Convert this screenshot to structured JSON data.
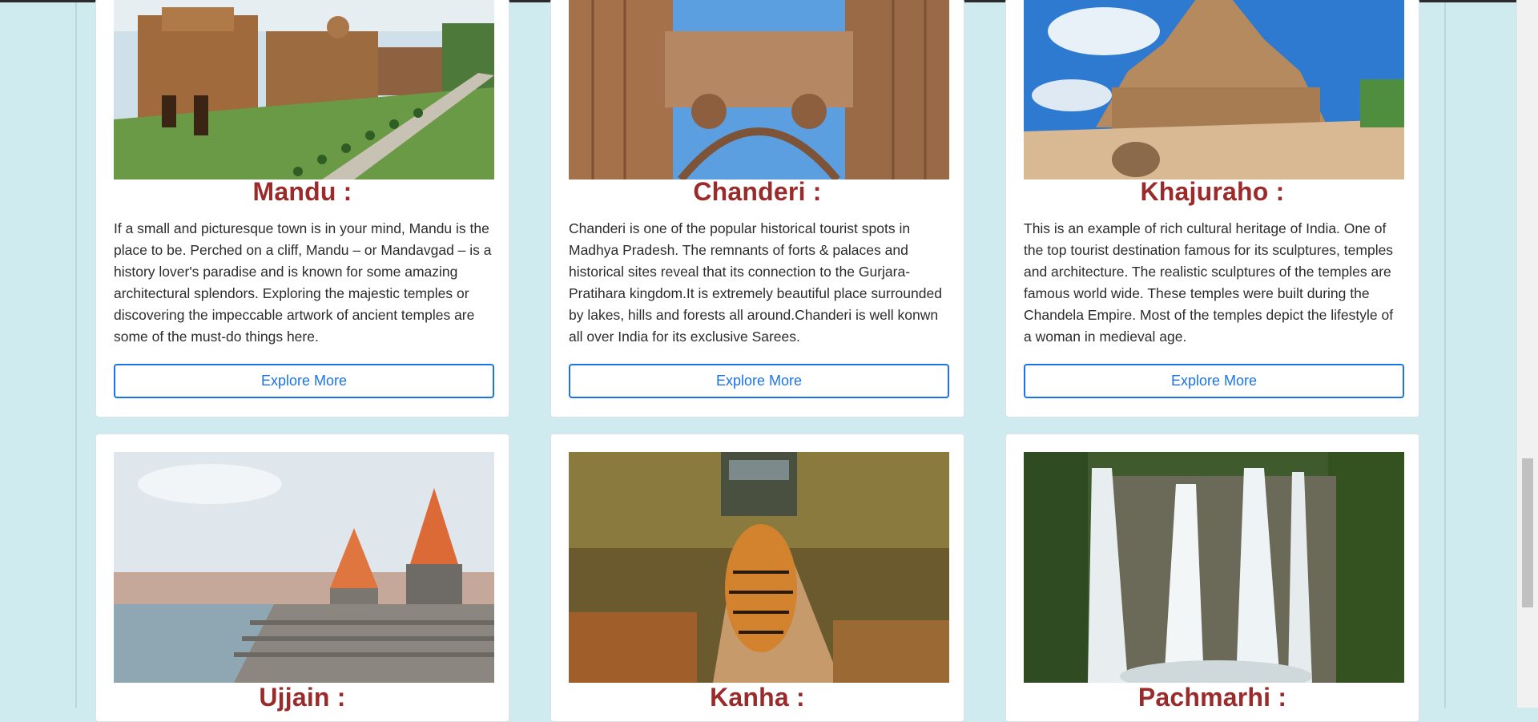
{
  "destinations": [
    {
      "title": "Mandu :",
      "image": "mandu-palace-photo",
      "description": "If a small and picturesque town is in your mind, Mandu is the place to be. Perched on a cliff, Mandu – or Mandavgad – is a history lover's paradise and is known for some amazing architectural splendors. Exploring the majestic temples or discovering the impeccable artwork of ancient temples are some of the must-do things here.",
      "button": "Explore More"
    },
    {
      "title": "Chanderi :",
      "image": "chanderi-gate-photo",
      "description": "Chanderi is one of the popular historical tourist spots in Madhya Pradesh. The remnants of forts & palaces and historical sites reveal that its connection to the Gurjara-Pratihara kingdom.It is extremely beautiful place surrounded by lakes, hills and forests all around.Chanderi is well konwn all over India for its exclusive Sarees.",
      "button": "Explore More"
    },
    {
      "title": "Khajuraho :",
      "image": "khajuraho-temple-photo",
      "description": "This is an example of rich cultural heritage of India. One of the top tourist destination famous for its sculptures, temples and architecture. The realistic sculptures of the temples are famous world wide. These temples were built during the Chandela Empire. Most of the temples depict the lifestyle of a woman in medieval age.",
      "button": "Explore More"
    },
    {
      "title": "Ujjain :",
      "image": "ujjain-ghat-photo"
    },
    {
      "title": "Kanha :",
      "image": "kanha-tiger-photo"
    },
    {
      "title": "Pachmarhi :",
      "image": "pachmarhi-waterfall-photo"
    }
  ],
  "colors": {
    "page_bg": "#cfebef",
    "heading": "#9b2b2b",
    "button": "#1a73e8"
  }
}
